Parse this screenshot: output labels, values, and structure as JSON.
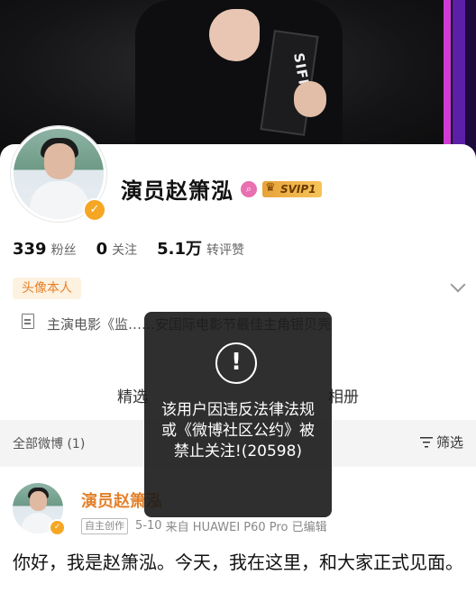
{
  "profile": {
    "name": "演员赵箫泓",
    "vip_label": "SVIP1",
    "followers_count": "339",
    "followers_label": "粉丝",
    "following_count": "0",
    "following_label": "关注",
    "interactions_count": "5.1万",
    "interactions_label": "转评赞",
    "tag": "头像本人",
    "intro_text": "主演电影《监……安国际电影节最佳主角银贝壳",
    "feature_left": "精选",
    "feature_right": "相册",
    "cover_trophy_text": "SIFF"
  },
  "feed": {
    "filter_label": "全部微博 (1)",
    "filter_button": "筛选"
  },
  "post": {
    "author": "演员赵箫泓",
    "self_badge": "自主创作",
    "date": "5-10",
    "source": "来自 HUAWEI P60 Pro",
    "edited": "已编辑",
    "text": "你好，我是赵箫泓。今天，我在这里，和大家正式见面。"
  },
  "toast": {
    "icon_glyph": "!",
    "message": "该用户因违反法律法规或《微博社区公约》被禁止关注!(20598)"
  },
  "colors": {
    "accent_orange": "#e3812b",
    "svip_gold": "#f6c45a",
    "toast_bg": "#181818"
  }
}
